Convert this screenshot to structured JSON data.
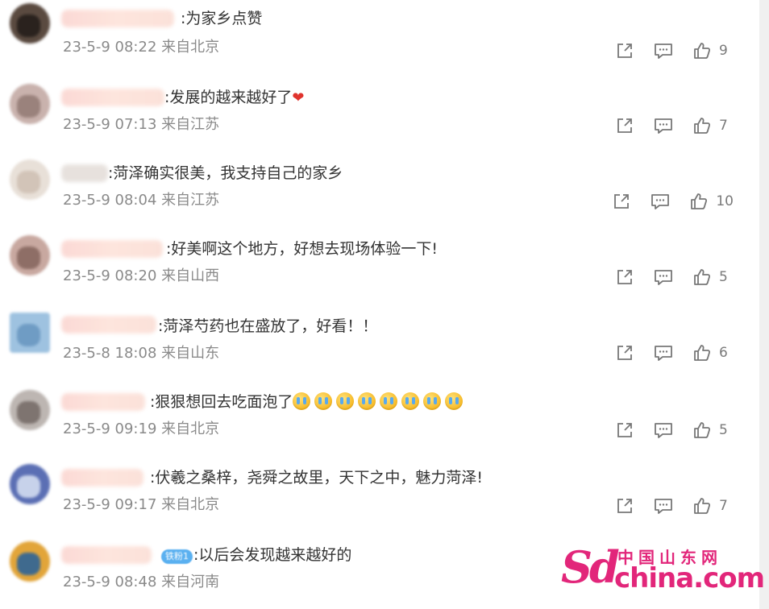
{
  "colors": {
    "watermark": "#e2267a",
    "meta_text": "#8a8a8a",
    "body_text": "#333333",
    "heart": "#e0332d"
  },
  "icons": {
    "share": "share-icon",
    "reply": "comment-icon",
    "like": "thumbs-up-icon"
  },
  "comments": [
    {
      "text": ":为家乡点赞",
      "meta": "23-5-9 08:22 来自北京",
      "likes": "9"
    },
    {
      "text": ":发展的越来越好了",
      "meta": "23-5-9 07:13 来自江苏",
      "likes": "7"
    },
    {
      "text": ":菏泽确实很美，我支持自己的家乡",
      "meta": "23-5-9 08:04 来自江苏",
      "likes": "10"
    },
    {
      "text": ":好美啊这个地方，好想去现场体验一下!",
      "meta": "23-5-9 08:20 来自山西",
      "likes": "5"
    },
    {
      "text": ":菏泽芍药也在盛放了，好看！！",
      "meta": "23-5-8 18:08 来自山东",
      "likes": "6"
    },
    {
      "text": ":狠狠想回去吃面泡了",
      "meta": "23-5-9 09:19 来自北京",
      "likes": "5"
    },
    {
      "text": ":伏羲之桑梓，尧舜之故里，天下之中，魅力菏泽!",
      "meta": "23-5-9 09:17 来自北京",
      "likes": "7"
    },
    {
      "text": ":以后会发现越来越好的",
      "meta": "23-5-9 08:48 来自河南",
      "badge": "铁粉1"
    }
  ],
  "watermark": {
    "sd": "Sd",
    "cn": "中国山东网",
    "domain": "china.com"
  }
}
